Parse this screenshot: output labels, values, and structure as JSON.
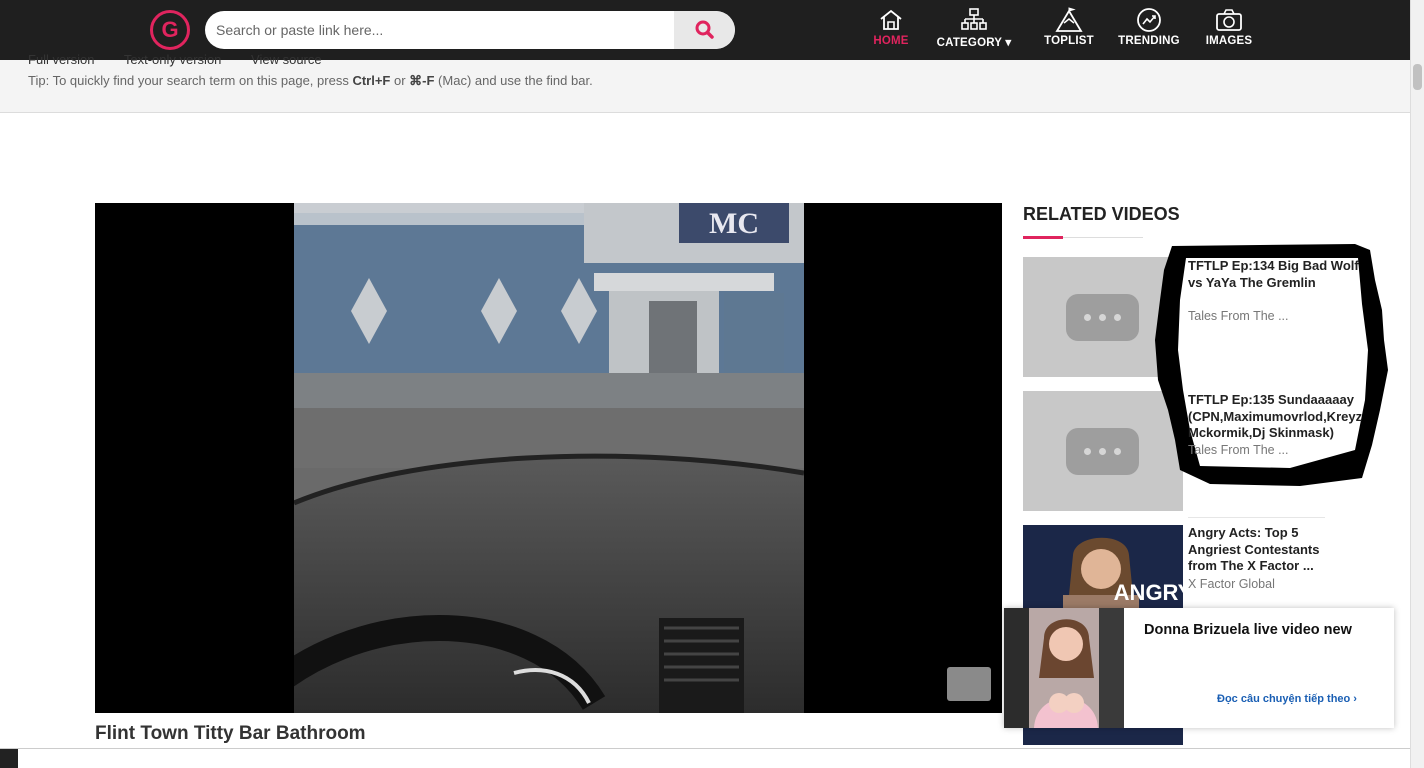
{
  "header": {
    "logo_letter": "G",
    "search_placeholder": "Search or paste link here...",
    "nav": [
      {
        "label": "HOME",
        "icon": "home-icon",
        "active": true
      },
      {
        "label": "CATEGORY ▾",
        "icon": "category-icon",
        "active": false
      },
      {
        "label": "TOPLIST",
        "icon": "toplist-icon",
        "active": false
      },
      {
        "label": "TRENDING",
        "icon": "trending-icon",
        "active": false
      },
      {
        "label": "IMAGES",
        "icon": "camera-icon",
        "active": false
      }
    ],
    "accent_color": "#e0245e"
  },
  "tipbar": {
    "links": [
      "Full version",
      "Text-only version",
      "View source"
    ],
    "tip_prefix": "Tip: To quickly find your search term on this page, press ",
    "key1": "Ctrl+F",
    "tip_or": " or ",
    "key2": "⌘-F",
    "tip_suffix": " (Mac) and use the find bar."
  },
  "video": {
    "title": "Flint Town Titty Bar Bathroom",
    "sign_text": "MC"
  },
  "related": {
    "heading": "RELATED VIDEOS",
    "items": [
      {
        "title": "TFTLP Ep:134 Big Bad Wolf vs YaYa The Gremlin",
        "channel": "Tales From The ..."
      },
      {
        "title": "TFTLP Ep:135 Sundaaaaay (CPN,Maximumovrlod,Kreyz Mckormik,Dj Skinmask)",
        "channel": "Tales From The ..."
      },
      {
        "title": "Angry Acts: Top 5 Angriest Contestants from The X Factor ...",
        "channel": "X Factor Global",
        "thumb_text": "ANGRY"
      }
    ]
  },
  "ad": {
    "title": "Donna Brizuela live video new",
    "link": "Đọc câu chuyện tiếp theo ›"
  }
}
